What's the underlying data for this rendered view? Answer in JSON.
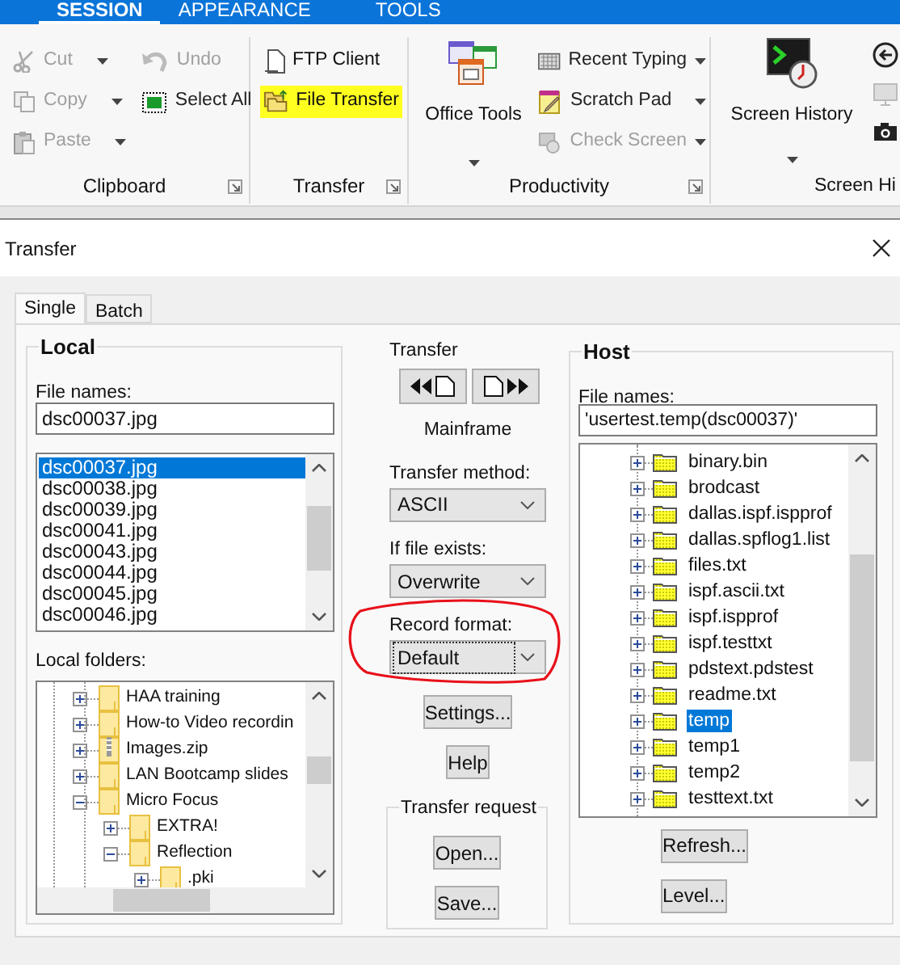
{
  "ribbon": {
    "tabs": [
      {
        "label": "SESSION",
        "selected": true
      },
      {
        "label": "APPEARANCE",
        "selected": false
      },
      {
        "label": "TOOLS",
        "selected": false
      }
    ],
    "clipboard": {
      "label": "Clipboard",
      "items": [
        {
          "label": "Cut",
          "disabled": true,
          "dropdown": true
        },
        {
          "label": "Copy",
          "disabled": true,
          "dropdown": true
        },
        {
          "label": "Paste",
          "disabled": true,
          "dropdown": true
        },
        {
          "label": "Undo",
          "disabled": true,
          "dropdown": false
        },
        {
          "label": "Select All",
          "disabled": false,
          "dropdown": false
        }
      ]
    },
    "transfer": {
      "label": "Transfer",
      "items": [
        {
          "label": "FTP Client",
          "highlighted": false
        },
        {
          "label": "File Transfer",
          "highlighted": true
        }
      ]
    },
    "productivity": {
      "label": "Productivity",
      "large": {
        "label": "Office Tools"
      },
      "items": [
        {
          "label": "Recent Typing",
          "disabled": false
        },
        {
          "label": "Scratch Pad",
          "disabled": false
        },
        {
          "label": "Check Screen",
          "disabled": true
        }
      ]
    },
    "screen_history": {
      "label": "Screen Hi",
      "large": {
        "label": "Screen History"
      }
    }
  },
  "dialog": {
    "title": "Transfer",
    "tabs": [
      {
        "label": "Single",
        "selected": true
      },
      {
        "label": "Batch",
        "selected": false
      }
    ],
    "local": {
      "title": "Local",
      "file_names_label": "File names:",
      "file_name": "dsc00037.jpg",
      "files": [
        {
          "name": "dsc00037.jpg",
          "selected": true
        },
        {
          "name": "dsc00038.jpg",
          "selected": false
        },
        {
          "name": "dsc00039.jpg",
          "selected": false
        },
        {
          "name": "dsc00041.jpg",
          "selected": false
        },
        {
          "name": "dsc00043.jpg",
          "selected": false
        },
        {
          "name": "dsc00044.jpg",
          "selected": false
        },
        {
          "name": "dsc00045.jpg",
          "selected": false
        },
        {
          "name": "dsc00046.jpg",
          "selected": false
        }
      ],
      "folders_label": "Local folders:",
      "folders": [
        {
          "label": "HAA training",
          "kind": "folder",
          "expanded": false
        },
        {
          "label": "How-to Video recordin",
          "kind": "folder",
          "expanded": false
        },
        {
          "label": "Images.zip",
          "kind": "zip",
          "expanded": false
        },
        {
          "label": "LAN Bootcamp slides",
          "kind": "folder",
          "expanded": false
        },
        {
          "label": "Micro Focus",
          "kind": "folder",
          "expanded": true,
          "children": [
            {
              "label": "EXTRA!",
              "kind": "folder",
              "expanded": false
            },
            {
              "label": "Reflection",
              "kind": "folder",
              "expanded": true,
              "children": [
                {
                  "label": ".pki",
                  "kind": "folder",
                  "expanded": false
                }
              ]
            }
          ]
        }
      ]
    },
    "transfer": {
      "label": "Transfer",
      "host_label": "Mainframe",
      "method_label": "Transfer method:",
      "method": "ASCII",
      "exists_label": "If file exists:",
      "exists": "Overwrite",
      "record_label": "Record format:",
      "record": "Default",
      "record_circled": true,
      "buttons": [
        "Settings...",
        "Help"
      ],
      "request_label": "Transfer request",
      "request_buttons": [
        "Open...",
        "Save..."
      ]
    },
    "host": {
      "title": "Host",
      "file_names_label": "File names:",
      "file_name": "'usertest.temp(dsc00037)'",
      "files": [
        {
          "name": "binary.bin",
          "selected": false
        },
        {
          "name": "brodcast",
          "selected": false
        },
        {
          "name": "dallas.ispf.ispprof",
          "selected": false
        },
        {
          "name": "dallas.spflog1.list",
          "selected": false
        },
        {
          "name": "files.txt",
          "selected": false
        },
        {
          "name": "ispf.ascii.txt",
          "selected": false
        },
        {
          "name": "ispf.ispprof",
          "selected": false
        },
        {
          "name": "ispf.testtxt",
          "selected": false
        },
        {
          "name": "pdstext.pdstest",
          "selected": false
        },
        {
          "name": "readme.txt",
          "selected": false
        },
        {
          "name": "temp",
          "selected": true
        },
        {
          "name": "temp1",
          "selected": false
        },
        {
          "name": "temp2",
          "selected": false
        },
        {
          "name": "testtext.txt",
          "selected": false
        }
      ],
      "buttons": [
        "Refresh...",
        "Level..."
      ]
    }
  }
}
